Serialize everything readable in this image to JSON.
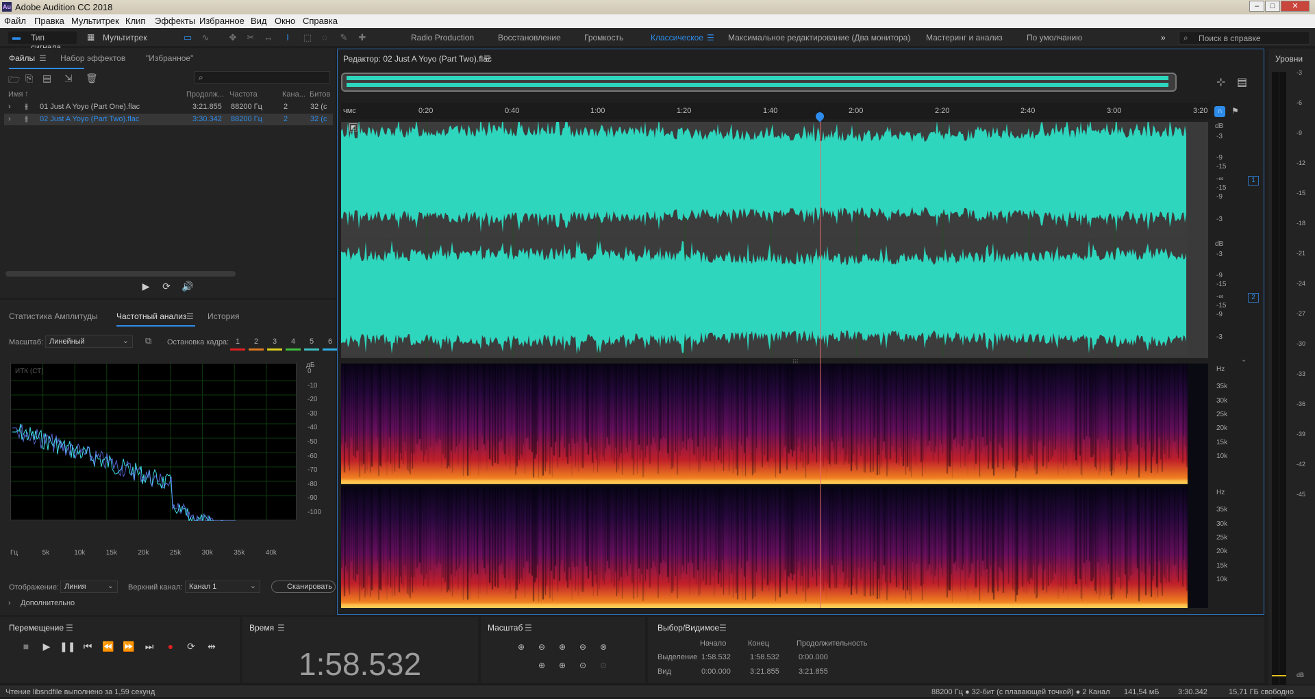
{
  "window": {
    "title": "Adobe Audition CC 2018",
    "logo": "Au"
  },
  "menu": [
    "Файл",
    "Правка",
    "Мультитрек",
    "Клип",
    "Эффекты",
    "Избранное",
    "Вид",
    "Окно",
    "Справка"
  ],
  "toolbar": {
    "mode_waveform": "Тип сигнала",
    "mode_multitrack": "Мультитрек",
    "workspaces": [
      "Radio Production",
      "Восстановление",
      "Громкость",
      "Классическое",
      "Максимальное редактирование (Два монитора)",
      "Мастеринг и анализ",
      "По умолчанию"
    ],
    "active_workspace": "Классическое",
    "help_search_placeholder": "Поиск в справке"
  },
  "files_panel": {
    "tabs": [
      "Файлы",
      "Набор эффектов",
      "\"Избранное\""
    ],
    "columns": [
      "Имя",
      "Продолж...",
      "Частота",
      "Кана...",
      "Битов"
    ],
    "rows": [
      {
        "name": "01 Just A Yoyo (Part One).flac",
        "duration": "3:21.855",
        "rate": "88200 Гц",
        "channels": "2",
        "bits": "32 (с"
      },
      {
        "name": "02 Just A Yoyo (Part Two).flac",
        "duration": "3:30.342",
        "rate": "88200 Гц",
        "channels": "2",
        "bits": "32 (с"
      }
    ],
    "search_placeholder": ""
  },
  "analysis_panel": {
    "tabs": [
      "Статистика Амплитуды",
      "Частотный анализ",
      "История"
    ],
    "scale_label": "Масштаб:",
    "scale_value": "Линейный",
    "hold_label": "Остановка кадра:",
    "holds": [
      "1",
      "2",
      "3",
      "4",
      "5",
      "6"
    ],
    "hold_colors": [
      "#e02020",
      "#e07a20",
      "#e0d020",
      "#40c040",
      "#40c0c0",
      "#30b0e8"
    ],
    "plot_label": "ИТК (СТ)",
    "db_unit": "дБ",
    "db_ticks": [
      "0",
      "-10",
      "-20",
      "-30",
      "-40",
      "-50",
      "-60",
      "-70",
      "-80",
      "-90",
      "-100"
    ],
    "freq_ticks": [
      "Гц",
      "5k",
      "10k",
      "15k",
      "20k",
      "25k",
      "30k",
      "35k",
      "40k"
    ],
    "display_label": "Отображение:",
    "display_value": "Линия",
    "channel_label": "Верхний канал:",
    "channel_value": "Канал 1",
    "scan_button": "Сканировать",
    "more_label": "Дополнительно"
  },
  "editor": {
    "title": "Редактор: 02 Just A Yoyo (Part Two).flac",
    "timeline_unit": "чмс",
    "timeline": [
      "0:20",
      "0:40",
      "1:00",
      "1:20",
      "1:40",
      "2:00",
      "2:20",
      "2:40",
      "3:00",
      "3:20"
    ],
    "db_label": "dB",
    "db_ticks": [
      "-3",
      "-9",
      "-15",
      "-∞",
      "-15",
      "-9",
      "-3"
    ],
    "channels": [
      "1",
      "2"
    ],
    "hz_label": "Hz",
    "hz_ticks": [
      "35k",
      "30k",
      "25k",
      "20k",
      "15k",
      "10k"
    ],
    "playhead_fraction": 0.5631,
    "waveform_color": "#2ed6be"
  },
  "levels": {
    "title": "Уровни",
    "ticks": [
      "-3",
      "-6",
      "-9",
      "-12",
      "-15",
      "-18",
      "-21",
      "-24",
      "-27",
      "-30",
      "-33",
      "-36",
      "-39",
      "-42",
      "-45"
    ],
    "unit": "dB"
  },
  "transport": {
    "title": "Перемещение"
  },
  "time": {
    "title": "Время",
    "value": "1:58.532"
  },
  "zoom": {
    "title": "Масштаб"
  },
  "selection": {
    "title": "Выбор/Видимое",
    "col_start": "Начало",
    "col_end": "Конец",
    "col_duration": "Продолжительность",
    "row_selection": "Выделение",
    "row_view": "Вид",
    "sel_start": "1:58.532",
    "sel_end": "1:58.532",
    "sel_dur": "0:00.000",
    "view_start": "0:00.000",
    "view_end": "3:21.855",
    "view_dur": "3:21.855"
  },
  "status": {
    "message": "Чтение libsndfile выполнено за 1,59 секунд",
    "format": "88200 Гц ● 32-бит (с плавающей точкой) ● 2 Канал",
    "size": "141,54 мБ",
    "duration": "3:30.342",
    "free": "15,71 ГБ свободно"
  }
}
